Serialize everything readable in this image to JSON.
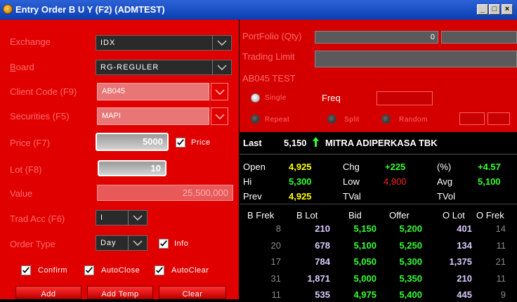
{
  "window": {
    "title": "Entry Order   B U Y (F2) (ADMTEST)",
    "minimize": "_",
    "maximize": "□",
    "close": "×"
  },
  "form": {
    "exchange": {
      "label": "Exchange",
      "value": "IDX"
    },
    "board": {
      "label": "Board",
      "value": "RG-REGULER"
    },
    "client_code": {
      "label": "Client Code (F9)",
      "value": "AB045"
    },
    "securities": {
      "label": "Securities (F5)",
      "value": "MAPI"
    },
    "price": {
      "label": "Price (F7)",
      "value": "5000",
      "check_label": "Price"
    },
    "lot": {
      "label": "Lot (F8)",
      "value": "10"
    },
    "value": {
      "label": "Value",
      "value": "25,500,000"
    },
    "trad_acc": {
      "label": "Trad Acc (F6)",
      "value": "I"
    },
    "order_type": {
      "label": "Order Type",
      "value": "Day",
      "check_label": "Info"
    },
    "checks": {
      "confirm": "Confirm",
      "autoclose": "AutoClose",
      "autoclear": "AutoClear"
    },
    "buttons": {
      "add": "Add",
      "add_temp": "Add Temp",
      "clear": "Clear"
    }
  },
  "portfolio": {
    "label": "PortFolio (Qty)",
    "qty": "0",
    "trading_limit_label": "Trading Limit",
    "client_name": "AB045 TEST",
    "single": "Single",
    "freq": "Freq",
    "repeat": "Repeat",
    "split": "Split",
    "random": "Random"
  },
  "quote": {
    "last_label": "Last",
    "last_value": "5,150",
    "name": "MITRA ADIPERKASA TBK",
    "open_label": "Open",
    "open": "4,925",
    "chg_label": "Chg",
    "chg": "+225",
    "pct_label": "(%)",
    "pct": "+4.57",
    "hi_label": "Hi",
    "hi": "5,300",
    "low_label": "Low",
    "low": "4,900",
    "avg_label": "Avg",
    "avg": "5,100",
    "prev_label": "Prev",
    "prev": "4,925",
    "tval_label": "TVal",
    "tvol_label": "TVol"
  },
  "book": {
    "headers": [
      "B Frek",
      "B Lot",
      "Bid",
      "Offer",
      "O Lot",
      "O Frek"
    ],
    "rows": [
      [
        "8",
        "210",
        "5,150",
        "5,200",
        "401",
        "14"
      ],
      [
        "20",
        "678",
        "5,100",
        "5,250",
        "134",
        "11"
      ],
      [
        "17",
        "784",
        "5,050",
        "5,300",
        "1,375",
        "21"
      ],
      [
        "31",
        "1,871",
        "5,000",
        "5,350",
        "210",
        "11"
      ],
      [
        "11",
        "535",
        "4,975",
        "5,400",
        "445",
        "9"
      ]
    ]
  },
  "colors": {
    "panel_red": "#e00000",
    "title_blue": "#0a3fb4",
    "label_pink": "#ff6a6a",
    "up_green": "#33ff33",
    "price_yellow": "#ffff00"
  }
}
